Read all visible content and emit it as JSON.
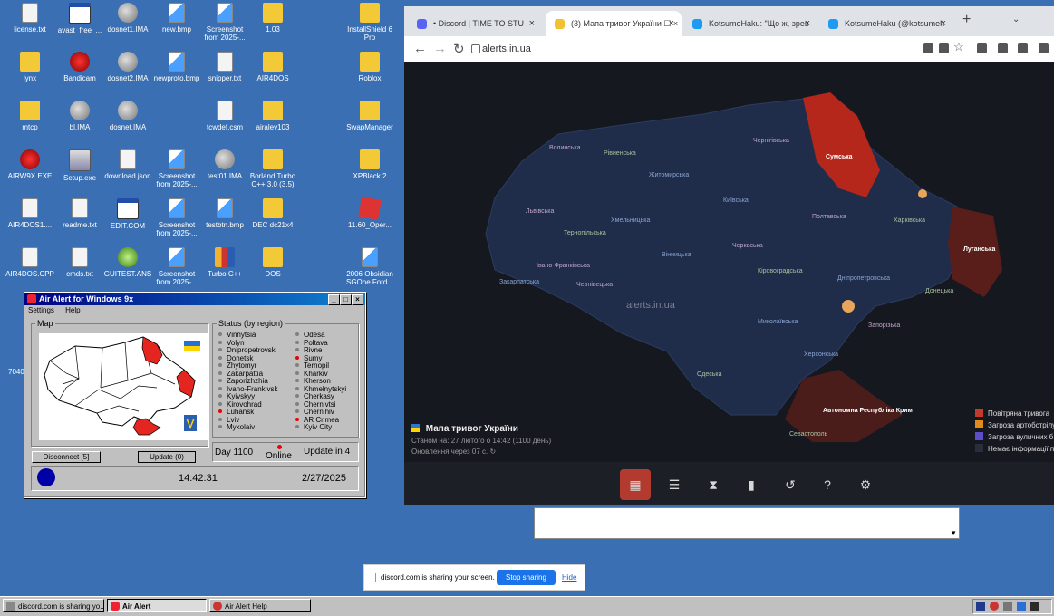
{
  "desktop": {
    "icons": [
      {
        "label": "license.txt",
        "kind": "file",
        "col": 0,
        "row": 0
      },
      {
        "label": "avast_free_...",
        "kind": "win",
        "col": 1,
        "row": 0
      },
      {
        "label": "dosnet1.IMA",
        "kind": "disk",
        "col": 2,
        "row": 0
      },
      {
        "label": "new.bmp",
        "kind": "img",
        "col": 3,
        "row": 0
      },
      {
        "label": "Screenshot from 2025-...",
        "kind": "img",
        "col": 4,
        "row": 0
      },
      {
        "label": "1.03",
        "kind": "folder",
        "col": 5,
        "row": 0
      },
      {
        "label": "InstallShield 6 Pro",
        "kind": "folder",
        "col": 7,
        "row": 0
      },
      {
        "label": "lynx",
        "kind": "folder",
        "col": 0,
        "row": 1
      },
      {
        "label": "Bandicam",
        "kind": "red",
        "col": 1,
        "row": 1
      },
      {
        "label": "dosnet2.IMA",
        "kind": "disk",
        "col": 2,
        "row": 1
      },
      {
        "label": "newproto.bmp",
        "kind": "img",
        "col": 3,
        "row": 1
      },
      {
        "label": "snipper.txt",
        "kind": "file",
        "col": 4,
        "row": 1
      },
      {
        "label": "AIR4DOS",
        "kind": "folder",
        "col": 5,
        "row": 1
      },
      {
        "label": "Roblox",
        "kind": "folder",
        "col": 7,
        "row": 1
      },
      {
        "label": "mtcp",
        "kind": "folder",
        "col": 0,
        "row": 2
      },
      {
        "label": "bl.IMA",
        "kind": "disk",
        "col": 1,
        "row": 2
      },
      {
        "label": "dosnet.IMA",
        "kind": "disk",
        "col": 2,
        "row": 2
      },
      {
        "label": "tcwdef.csm",
        "kind": "file",
        "col": 4,
        "row": 2
      },
      {
        "label": "airalev103",
        "kind": "folder",
        "col": 5,
        "row": 2
      },
      {
        "label": "SwapManager",
        "kind": "folder",
        "col": 7,
        "row": 2
      },
      {
        "label": "AIRW9X.EXE",
        "kind": "red",
        "col": 0,
        "row": 3
      },
      {
        "label": "Setup.exe",
        "kind": "app",
        "col": 1,
        "row": 3
      },
      {
        "label": "download.json",
        "kind": "file",
        "col": 2,
        "row": 3
      },
      {
        "label": "Screenshot from 2025-...",
        "kind": "img",
        "col": 3,
        "row": 3
      },
      {
        "label": "test01.IMA",
        "kind": "disk",
        "col": 4,
        "row": 3
      },
      {
        "label": "Borland Turbo C++ 3.0 (3.5)",
        "kind": "folder",
        "col": 5,
        "row": 3
      },
      {
        "label": "XPBlack 2",
        "kind": "folder",
        "col": 7,
        "row": 3
      },
      {
        "label": "AIR4DOS1....",
        "kind": "file",
        "col": 0,
        "row": 4
      },
      {
        "label": "readme.txt",
        "kind": "file",
        "col": 1,
        "row": 4
      },
      {
        "label": "EDIT.COM",
        "kind": "win",
        "col": 2,
        "row": 4
      },
      {
        "label": "Screenshot from 2025-...",
        "kind": "img",
        "col": 3,
        "row": 4
      },
      {
        "label": "testbtn.bmp",
        "kind": "img",
        "col": 4,
        "row": 4
      },
      {
        "label": "DEC dc21x4",
        "kind": "folder",
        "col": 5,
        "row": 4
      },
      {
        "label": "11.60_Oper...",
        "kind": "box",
        "col": 7,
        "row": 4
      },
      {
        "label": "AIR4DOS.CPP",
        "kind": "file",
        "col": 0,
        "row": 5
      },
      {
        "label": "cmds.txt",
        "kind": "file",
        "col": 1,
        "row": 5
      },
      {
        "label": "GUITEST.ANS",
        "kind": "green",
        "col": 2,
        "row": 5
      },
      {
        "label": "Screenshot from 2025-...",
        "kind": "img",
        "col": 3,
        "row": 5
      },
      {
        "label": "Turbo C++",
        "kind": "multi",
        "col": 4,
        "row": 5
      },
      {
        "label": "DOS",
        "kind": "folder",
        "col": 5,
        "row": 5
      },
      {
        "label": "2006 Obsidian SGOne Ford...",
        "kind": "img",
        "col": 7,
        "row": 5
      }
    ],
    "side_text": "7040"
  },
  "airalert": {
    "title": "Air Alert for Windows 9x",
    "menu": [
      "Settings",
      "Help"
    ],
    "map_legend": "Map",
    "status_legend": "Status (by region)",
    "regions_left": [
      {
        "name": "Vinnytsia",
        "alert": false
      },
      {
        "name": "Volyn",
        "alert": false
      },
      {
        "name": "Dnipropetrovsk",
        "alert": false
      },
      {
        "name": "Donetsk",
        "alert": false
      },
      {
        "name": "Zhytomyr",
        "alert": false
      },
      {
        "name": "Zakarpattia",
        "alert": false
      },
      {
        "name": "Zaporizhzhia",
        "alert": false
      },
      {
        "name": "Ivano-Frankivsk",
        "alert": false
      },
      {
        "name": "Kyivskyy",
        "alert": false
      },
      {
        "name": "Kirovohrad",
        "alert": false
      },
      {
        "name": "Luhansk",
        "alert": true
      },
      {
        "name": "Lviv",
        "alert": false
      },
      {
        "name": "Mykolaiv",
        "alert": false
      }
    ],
    "regions_right": [
      {
        "name": "Odesa",
        "alert": false
      },
      {
        "name": "Poltava",
        "alert": false
      },
      {
        "name": "Rivne",
        "alert": false
      },
      {
        "name": "Sumy",
        "alert": true
      },
      {
        "name": "Ternopil",
        "alert": false
      },
      {
        "name": "Kharkiv",
        "alert": false
      },
      {
        "name": "Kherson",
        "alert": false
      },
      {
        "name": "Khmelnytskyi",
        "alert": false
      },
      {
        "name": "Cherkasy",
        "alert": false
      },
      {
        "name": "Chernivtsi",
        "alert": false
      },
      {
        "name": "Chernihiv",
        "alert": false
      },
      {
        "name": "AR Crimea",
        "alert": true
      },
      {
        "name": "Kyiv City",
        "alert": false
      }
    ],
    "disconnect_label": "Disconnect [5]",
    "update_label": "Update (0)",
    "day_label": "Day 1100",
    "online_label": "Online",
    "update_in_label": "Update in 4",
    "time": "14:42:31",
    "date": "2/27/2025"
  },
  "browser": {
    "tabs": [
      {
        "title": "• Discord | TIME TO STU",
        "color": "#5865f2"
      },
      {
        "title": "(3) Мапа тривог України ☐ ×",
        "color": "#f2c030",
        "active": true
      },
      {
        "title": "KotsumeHaku: \"Що ж, зрев",
        "color": "#1d9bf0"
      },
      {
        "title": "KotsumeHaku (@kotsumeh",
        "color": "#1d9bf0"
      }
    ],
    "url": "alerts.in.ua",
    "map": {
      "watermark": "alerts.in.ua",
      "regions": [
        {
          "name": "Волинська",
          "alert": false
        },
        {
          "name": "Рівненська",
          "alert": false
        },
        {
          "name": "Житомирська",
          "alert": false
        },
        {
          "name": "Чернігівська",
          "alert": false
        },
        {
          "name": "Сумська",
          "alert": true
        },
        {
          "name": "Київська",
          "alert": false
        },
        {
          "name": "Львівська",
          "alert": false
        },
        {
          "name": "Тернопільська",
          "alert": false
        },
        {
          "name": "Хмельницька",
          "alert": false
        },
        {
          "name": "Полтавська",
          "alert": false
        },
        {
          "name": "Харківська",
          "alert": false
        },
        {
          "name": "Вінницька",
          "alert": false
        },
        {
          "name": "Черкаська",
          "alert": false
        },
        {
          "name": "Луганська",
          "alert": true
        },
        {
          "name": "Закарпатська",
          "alert": false
        },
        {
          "name": "Івано-Франківська",
          "alert": false
        },
        {
          "name": "Кіровоградська",
          "alert": false
        },
        {
          "name": "Дніпропетровська",
          "alert": false
        },
        {
          "name": "Чернівецька",
          "alert": false
        },
        {
          "name": "Донецька",
          "alert": false
        },
        {
          "name": "Миколаївська",
          "alert": false
        },
        {
          "name": "Запорізька",
          "alert": false
        },
        {
          "name": "Одеська",
          "alert": false
        },
        {
          "name": "Херсонська",
          "alert": false
        },
        {
          "name": "Автономна Республіка Крим",
          "alert": true
        },
        {
          "name": "Севастополь",
          "alert": false
        }
      ],
      "legend": [
        {
          "label": "Повітряна тривога",
          "color": "#c23a2b"
        },
        {
          "label": "Загроза артобстрілу",
          "color": "#e08a1c"
        },
        {
          "label": "Загроза вуличних б",
          "color": "#5b4fc7"
        },
        {
          "label": "Немає інформації п",
          "color": "#2a2d3a"
        }
      ],
      "info_title": "Мапа тривог України",
      "info_line1": "Станом на: 27 лютого о 14:42 (1100 день)",
      "info_line2": "Оновлення через 07 с."
    },
    "nav_icons": [
      "map-icon",
      "list-icon",
      "hourglass-icon",
      "chart-icon",
      "history-icon",
      "help-icon",
      "settings-icon"
    ]
  },
  "discord_share": {
    "text": "discord.com is sharing your screen.",
    "stop": "Stop sharing",
    "hide": "Hide"
  },
  "taskbar": {
    "items": [
      {
        "label": "discord.com is sharing yo...",
        "pressed": false
      },
      {
        "label": "Air Alert",
        "pressed": true
      },
      {
        "label": "Air Alert Help",
        "pressed": false
      }
    ]
  },
  "colors": {
    "desktop": "#3a70b3",
    "alert": "#c0291c",
    "title_bar": "#000080"
  }
}
